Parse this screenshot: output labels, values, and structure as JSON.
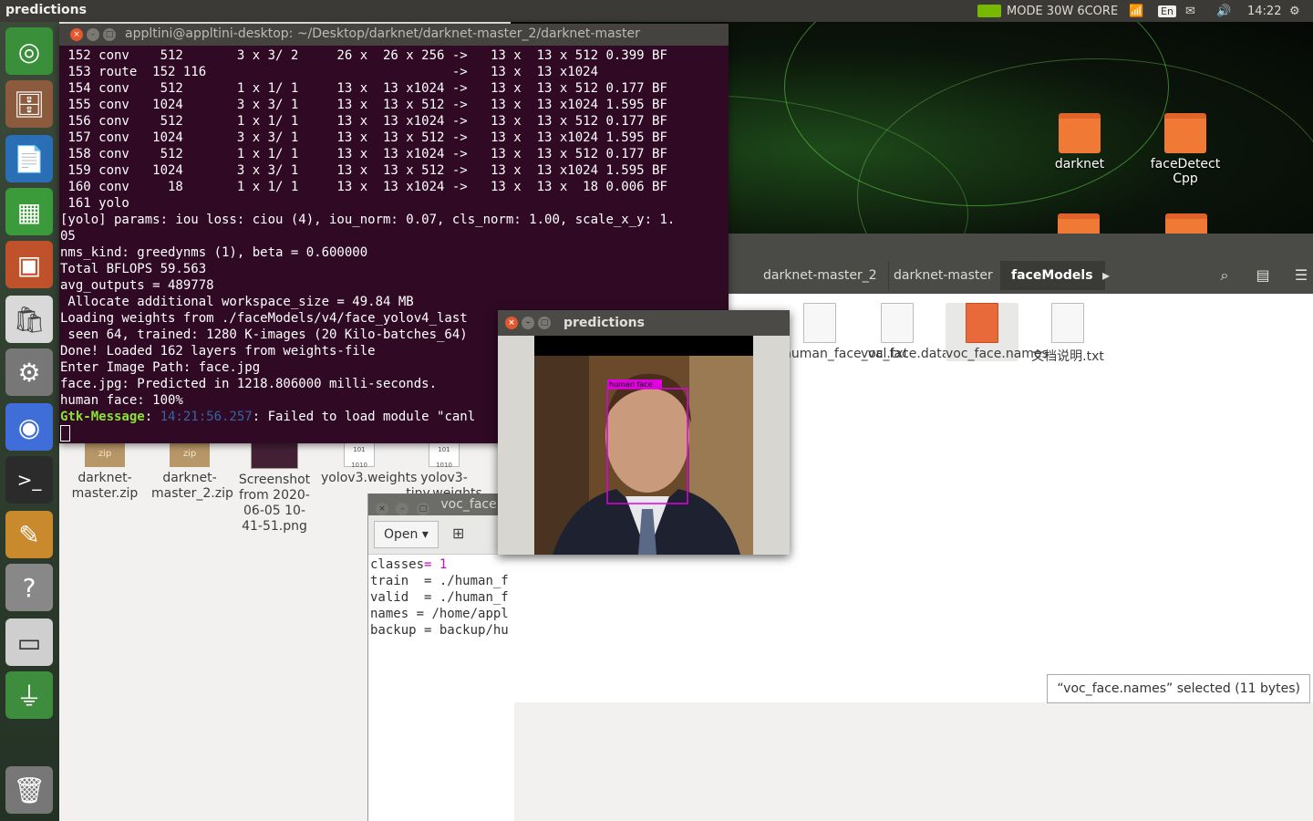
{
  "topbar": {
    "app_title": "predictions",
    "gpu_mode": "MODE 30W 6CORE",
    "keyboard": "En",
    "time": "14:22"
  },
  "launcher": {
    "items": [
      "ubuntu-dash",
      "files",
      "libreoffice-writer",
      "libreoffice-calc",
      "libreoffice-impress",
      "software-center",
      "system-settings",
      "chromium",
      "terminal",
      "text-editor",
      "help",
      "drive",
      "usb",
      "trash"
    ]
  },
  "desktop": {
    "icons": [
      {
        "label": "darknet"
      },
      {
        "label": "faceDetect Cpp"
      }
    ],
    "files": [
      {
        "label": "darknet-master.zip",
        "kind": "zip"
      },
      {
        "label": "darknet-master_2.zip",
        "kind": "zip"
      },
      {
        "label": "Screenshot from 2020-06-05 10-41-51.png",
        "kind": "png"
      },
      {
        "label": "yolov3.weights",
        "kind": "bin"
      },
      {
        "label": "yolov3-tiny.weights",
        "kind": "bin"
      }
    ]
  },
  "nautilus": {
    "breadcrumbs": [
      "darknet-master_2",
      "darknet-master",
      "faceModels"
    ],
    "files": [
      {
        "label": "human_face_val.txt"
      },
      {
        "label": "voc_face.data"
      },
      {
        "label": "voc_face.names"
      },
      {
        "label": "文档说明.txt"
      }
    ],
    "status": "“voc_face.names” selected  (11 bytes)"
  },
  "terminal": {
    "title": "appltini@appltini-desktop: ~/Desktop/darknet/darknet-master_2/darknet-master",
    "lines": [
      " 152 conv    512       3 x 3/ 2     26 x  26 x 256 ->   13 x  13 x 512 0.399 BF",
      " 153 route  152 116                                ->   13 x  13 x1024",
      " 154 conv    512       1 x 1/ 1     13 x  13 x1024 ->   13 x  13 x 512 0.177 BF",
      " 155 conv   1024       3 x 3/ 1     13 x  13 x 512 ->   13 x  13 x1024 1.595 BF",
      " 156 conv    512       1 x 1/ 1     13 x  13 x1024 ->   13 x  13 x 512 0.177 BF",
      " 157 conv   1024       3 x 3/ 1     13 x  13 x 512 ->   13 x  13 x1024 1.595 BF",
      " 158 conv    512       1 x 1/ 1     13 x  13 x1024 ->   13 x  13 x 512 0.177 BF",
      " 159 conv   1024       3 x 3/ 1     13 x  13 x 512 ->   13 x  13 x1024 1.595 BF",
      " 160 conv     18       1 x 1/ 1     13 x  13 x1024 ->   13 x  13 x  18 0.006 BF",
      " 161 yolo",
      "[yolo] params: iou loss: ciou (4), iou_norm: 0.07, cls_norm: 1.00, scale_x_y: 1.",
      "05",
      "nms_kind: greedynms (1), beta = 0.600000",
      "Total BFLOPS 59.563",
      "avg_outputs = 489778",
      " Allocate additional workspace_size = 49.84 MB",
      "Loading weights from ./faceModels/v4/face_yolov4_last",
      " seen 64, trained: 1280 K-images (20 Kilo-batches_64)",
      "Done! Loaded 162 layers from weights-file",
      "Enter Image Path: face.jpg",
      "face.jpg: Predicted in 1218.806000 milli-seconds.",
      "human face: 100%"
    ],
    "gtk_label": "Gtk-Message",
    "gtk_time": "14:21:56.257",
    "gtk_text": ": Failed to load module \"canl"
  },
  "predictions": {
    "title": "predictions",
    "detection_label": "human face"
  },
  "gedit": {
    "title": "voc_face.c",
    "open_label": "Open",
    "lines": [
      {
        "key": "classes",
        "eq": "= ",
        "val": "1"
      },
      {
        "key": "train  ",
        "eq": "= ",
        "val": "./human_f"
      },
      {
        "key": "valid  ",
        "eq": "= ",
        "val": "./human_f"
      },
      {
        "key": "names ",
        "eq": "= ",
        "val": "/home/appl"
      },
      {
        "key": "backup ",
        "eq": "= ",
        "val": "backup/hu"
      }
    ]
  },
  "colors": {
    "terminal_bg": "#300a24",
    "box": "#e000e0",
    "accent": "#f07936"
  }
}
